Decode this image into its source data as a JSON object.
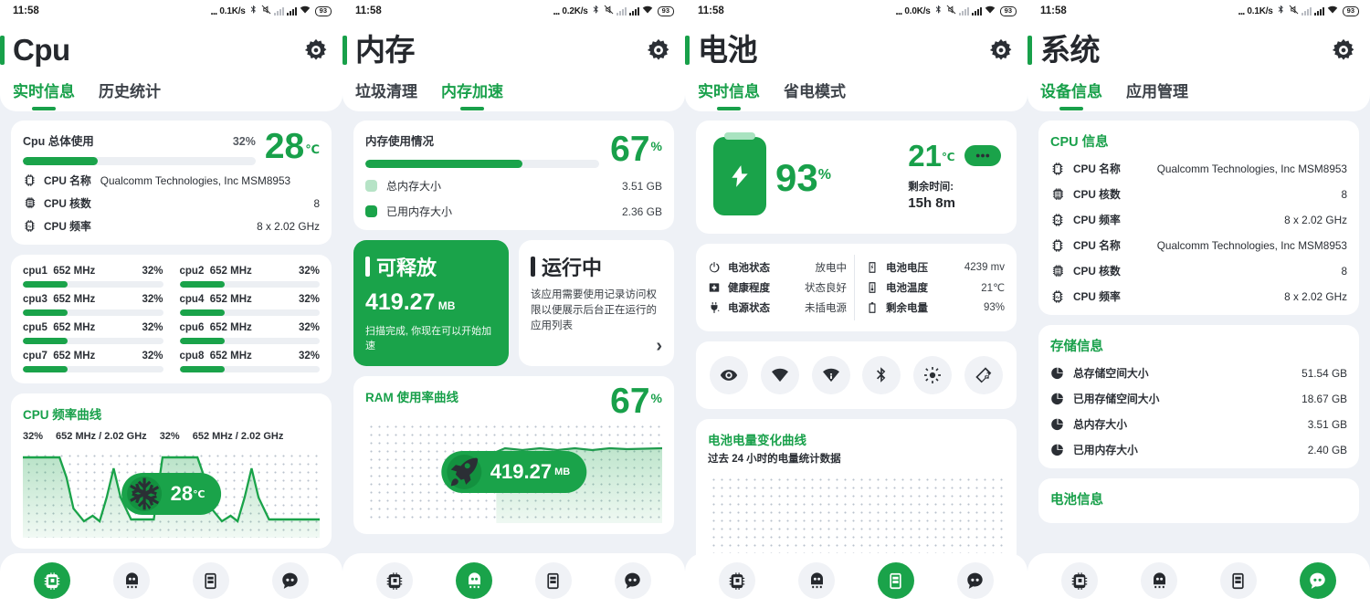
{
  "theme": {
    "accent": "#1aa34a",
    "accent_dark": "#18a04a",
    "bg": "#eef1f6",
    "card": "#ffffff",
    "text": "#2b2f35",
    "track": "#eceff3"
  },
  "statusbar": {
    "time": "11:58",
    "dots": "...",
    "speeds": [
      "0.1K/s",
      "0.2K/s",
      "0.0K/s",
      "0.1K/s"
    ],
    "battery_badge": "93"
  },
  "panels": [
    {
      "id": "cpu",
      "title": "Cpu",
      "tabs": [
        {
          "label": "实时信息",
          "active": true
        },
        {
          "label": "历史统计",
          "active": false
        }
      ],
      "nav_active": 0,
      "overall": {
        "label": "Cpu 总体使用",
        "percent_label": "32%",
        "percent": 32,
        "temp": "28",
        "temp_unit": "℃"
      },
      "info": [
        {
          "icon": "cpu-chip-icon",
          "key": "CPU 名称",
          "value": "Qualcomm Technologies, Inc MSM8953",
          "inline": true
        },
        {
          "icon": "cpu-cores-icon",
          "key": "CPU 核数",
          "value": "8",
          "inline": false
        },
        {
          "icon": "cpu-freq-icon",
          "key": "CPU 频率",
          "value": "8 x 2.02 GHz",
          "inline": false
        }
      ],
      "cores": [
        {
          "name": "cpu1",
          "freq": "652 MHz",
          "percent_label": "32%",
          "percent": 32
        },
        {
          "name": "cpu2",
          "freq": "652 MHz",
          "percent_label": "32%",
          "percent": 32
        },
        {
          "name": "cpu3",
          "freq": "652 MHz",
          "percent_label": "32%",
          "percent": 32
        },
        {
          "name": "cpu4",
          "freq": "652 MHz",
          "percent_label": "32%",
          "percent": 32
        },
        {
          "name": "cpu5",
          "freq": "652 MHz",
          "percent_label": "32%",
          "percent": 32
        },
        {
          "name": "cpu6",
          "freq": "652 MHz",
          "percent_label": "32%",
          "percent": 32
        },
        {
          "name": "cpu7",
          "freq": "652 MHz",
          "percent_label": "32%",
          "percent": 32
        },
        {
          "name": "cpu8",
          "freq": "652 MHz",
          "percent_label": "32%",
          "percent": 32
        }
      ],
      "chart": {
        "title": "CPU 频率曲线",
        "sub": [
          "32%",
          "652 MHz / 2.02 GHz",
          "32%",
          "652 MHz / 2.02 GHz"
        ],
        "pill_icon": "snowflake-icon",
        "pill_value": "28",
        "pill_unit": "℃"
      }
    },
    {
      "id": "memory",
      "title": "内存",
      "tabs": [
        {
          "label": "垃圾清理",
          "active": false
        },
        {
          "label": "内存加速",
          "active": true
        }
      ],
      "nav_active": 1,
      "usage": {
        "label": "内存使用情况",
        "percent_label": "67",
        "percent_unit": "%",
        "percent": 67,
        "legend": [
          {
            "swatch": "#b6e3c6",
            "label": "总内存大小",
            "value": "3.51 GB"
          },
          {
            "swatch": "#1aa34a",
            "label": "已用内存大小",
            "value": "2.36 GB"
          }
        ]
      },
      "release": {
        "heading": "可释放",
        "value": "419.27",
        "unit": "MB",
        "sub": "扫描完成, 你现在可以开始加速"
      },
      "running": {
        "heading": "运行中",
        "desc": "该应用需要使用记录访问权限以便展示后台正在运行的应用列表",
        "arrow": "›"
      },
      "chart": {
        "title": "RAM 使用率曲线",
        "percent_label": "67",
        "percent_unit": "%",
        "pill_icon": "rocket-icon",
        "pill_value": "419.27",
        "pill_unit": "MB"
      }
    },
    {
      "id": "battery",
      "title": "电池",
      "tabs": [
        {
          "label": "实时信息",
          "active": true
        },
        {
          "label": "省电模式",
          "active": false
        }
      ],
      "nav_active": 2,
      "hero": {
        "battery_icon": "battery-bolt-icon",
        "percent": "93",
        "percent_unit": "%",
        "temp": "21",
        "temp_unit": "℃",
        "remain_label": "剩余时间:",
        "remain_value": "15h 8m",
        "more_icon": "more-dots-icon"
      },
      "stats_left": [
        {
          "icon": "power-icon",
          "key": "电池状态",
          "value": "放电中"
        },
        {
          "icon": "health-icon",
          "key": "健康程度",
          "value": "状态良好"
        },
        {
          "icon": "plug-icon",
          "key": "电源状态",
          "value": "未插电源"
        }
      ],
      "stats_right": [
        {
          "icon": "voltage-icon",
          "key": "电池电压",
          "value": "4239 mv"
        },
        {
          "icon": "thermo-icon",
          "key": "电池温度",
          "value": "21℃"
        },
        {
          "icon": "battery-level-icon",
          "key": "剩余电量",
          "value": "93%"
        }
      ],
      "toggles": [
        "eye-icon",
        "wifi-icon",
        "wifi-info-icon",
        "bluetooth-icon",
        "brightness-icon",
        "rotation-lock-icon"
      ],
      "chart": {
        "title": "电池电量变化曲线",
        "sub": "过去 24 小时的电量统计数据"
      }
    },
    {
      "id": "system",
      "title": "系统",
      "tabs": [
        {
          "label": "设备信息",
          "active": true
        },
        {
          "label": "应用管理",
          "active": false
        }
      ],
      "nav_active": 3,
      "sections": [
        {
          "title": "CPU 信息",
          "rows": [
            {
              "icon": "cpu-chip-icon",
              "key": "CPU 名称",
              "value": "Qualcomm Technologies, Inc MSM8953"
            },
            {
              "icon": "cpu-cores-icon",
              "key": "CPU 核数",
              "value": "8"
            },
            {
              "icon": "cpu-freq-icon",
              "key": "CPU 频率",
              "value": "8 x 2.02 GHz"
            },
            {
              "icon": "cpu-chip-icon",
              "key": "CPU 名称",
              "value": "Qualcomm Technologies, Inc MSM8953"
            },
            {
              "icon": "cpu-cores-icon",
              "key": "CPU 核数",
              "value": "8"
            },
            {
              "icon": "cpu-freq-icon",
              "key": "CPU 频率",
              "value": "8 x 2.02 GHz"
            }
          ]
        },
        {
          "title": "存储信息",
          "rows": [
            {
              "icon": "pie-icon",
              "key": "总存储空间大小",
              "value": "51.54 GB"
            },
            {
              "icon": "pie-icon",
              "key": "已用存储空间大小",
              "value": "18.67 GB"
            },
            {
              "icon": "pie-icon",
              "key": "总内存大小",
              "value": "3.51 GB"
            },
            {
              "icon": "pie-icon",
              "key": "已用内存大小",
              "value": "2.40 GB"
            }
          ]
        },
        {
          "title": "电池信息",
          "rows": []
        }
      ]
    }
  ],
  "nav": {
    "items": [
      {
        "icon": "cpu-nav-icon",
        "name": "cpu"
      },
      {
        "icon": "memory-ghost-nav-icon",
        "name": "memory"
      },
      {
        "icon": "battery-nav-icon",
        "name": "battery"
      },
      {
        "icon": "system-chat-nav-icon",
        "name": "system"
      }
    ]
  },
  "chart_data": {
    "type": "line",
    "title": "CPU 频率曲线 / RAM 使用率曲线 / 电池电量变化曲线",
    "charts": [
      {
        "id": "cpu-freq-curve",
        "type": "area",
        "title": "CPU 频率曲线",
        "ylabel": "MHz",
        "ylim": [
          0,
          2020
        ],
        "annotations": [
          "32%",
          "652 MHz / 2.02 GHz",
          "28℃"
        ],
        "y": [
          1900,
          1900,
          1900,
          1880,
          900,
          340,
          300,
          300,
          420,
          300,
          1550,
          1700,
          900,
          380,
          380,
          380,
          1880,
          1900,
          1900,
          1880,
          900,
          340,
          300,
          300,
          420,
          300,
          1550,
          1700,
          900,
          380,
          380,
          380
        ]
      },
      {
        "id": "ram-usage-curve",
        "type": "area",
        "title": "RAM 使用率曲线",
        "ylabel": "%",
        "ylim": [
          0,
          100
        ],
        "annotations": [
          "67%",
          "419.27 MB"
        ],
        "y": [
          null,
          null,
          null,
          null,
          null,
          null,
          null,
          null,
          null,
          null,
          null,
          null,
          67,
          68,
          67,
          67,
          68,
          67,
          67,
          67,
          68,
          67,
          67,
          67,
          68,
          67,
          67,
          67
        ]
      },
      {
        "id": "battery-level-curve",
        "type": "line",
        "title": "电池电量变化曲线",
        "subtitle": "过去 24 小时的电量统计数据",
        "ylabel": "%",
        "ylim": [
          0,
          100
        ],
        "y": []
      }
    ]
  }
}
